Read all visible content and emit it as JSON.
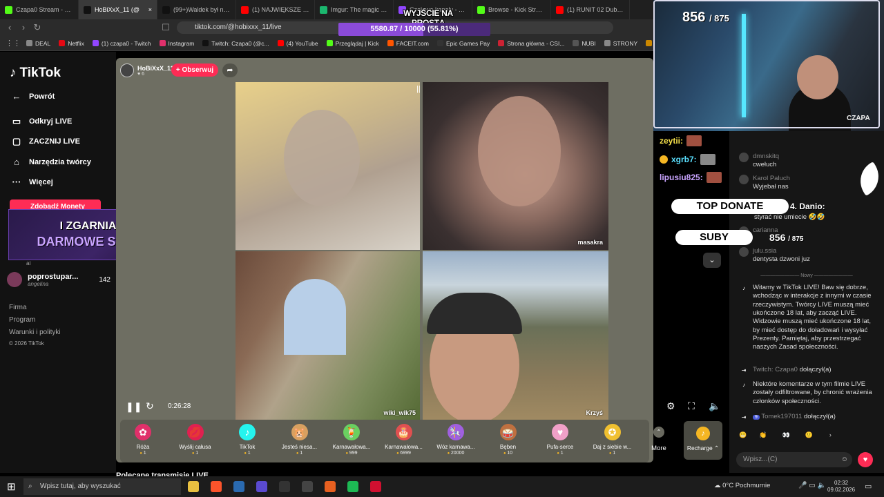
{
  "browser": {
    "tabs": [
      {
        "label": "Czapa0 Stream - Watc",
        "color": "#53fc18",
        "active": false
      },
      {
        "label": "HoBiXxX_11 (@",
        "color": "#111111",
        "active": true
      },
      {
        "label": "(99+)Waldek był na wy",
        "color": "#111111",
        "active": false
      },
      {
        "label": "(1) NAJWIĘKSZE WYGR",
        "color": "#ff0000",
        "active": false
      },
      {
        "label": "Imgur: The magic of th",
        "color": "#1bb76e",
        "active": false
      },
      {
        "label": "Czołowe kanały - Twitc",
        "color": "#9146ff",
        "active": false
      },
      {
        "label": "Browse - Kick Streamin",
        "color": "#53fc18",
        "active": false
      },
      {
        "label": "(1) RUNIT 02 Dubai - E",
        "color": "#ff0000",
        "active": false
      }
    ],
    "url": "tiktok.com/@hobixxx_11/live",
    "bookmarks": [
      {
        "label": "DEAL",
        "color": "#888888"
      },
      {
        "label": "Netflix",
        "color": "#e50914"
      },
      {
        "label": "(1) czapa0 - Twitch",
        "color": "#9146ff"
      },
      {
        "label": "Instagram",
        "color": "#e1306c"
      },
      {
        "label": "Twitch: Czapa0 (@c...",
        "color": "#111111"
      },
      {
        "label": "(4) YouTube",
        "color": "#ff0000"
      },
      {
        "label": "Przeglądaj | Kick",
        "color": "#53fc18"
      },
      {
        "label": "FACEIT.com",
        "color": "#ff5500"
      },
      {
        "label": "Epic Games Pay",
        "color": "#333333"
      },
      {
        "label": "Strona główna - CSI...",
        "color": "#cc2233"
      },
      {
        "label": "NUBI",
        "color": "#555555"
      },
      {
        "label": "STRONY",
        "color": "#888888"
      },
      {
        "label": "Skrzynki CS",
        "color": "#cc8800"
      }
    ]
  },
  "overlay": {
    "sub_goal_title": "WYJŚCIE NA PROSTĄ",
    "sub_goal_text": "5580.87 / 10000 (55.81%)",
    "sub_goal_progress": 0.5581,
    "viewers": "856",
    "viewers_goal": "/ 875",
    "cam_name": "CZAPA",
    "twitch_chat": [
      {
        "user": "zeytii:",
        "color": "#f5e04a"
      },
      {
        "user": "xgrb7:",
        "color": "#5ae0ff"
      },
      {
        "user": "lipusiu825:",
        "color": "#c9a4ff"
      }
    ],
    "top_donate_label": "TOP DONATE",
    "top_donate_amount": "",
    "top_donate_rank": "4. Danio:",
    "subs_label": "SUBY",
    "subs_count": "856",
    "subs_goal": "/ 875"
  },
  "sidebar": {
    "logo": "TikTok",
    "back": "Powrót",
    "items": [
      {
        "label": "Odkryj LIVE",
        "icon": "tv-icon"
      },
      {
        "label": "ZACZNIJ LIVE",
        "icon": "camera-icon"
      },
      {
        "label": "Narzędzia twórcy",
        "icon": "lightbulb-icon"
      },
      {
        "label": "Więcej",
        "icon": "ellipsis-icon"
      }
    ],
    "coins_button": "Zdobądź Monety",
    "promo_line1": "I ZGARNIAJ",
    "promo_line2": "DARMOWE SKINY",
    "following": [
      {
        "name": "poprostupar...",
        "sub": "angelina",
        "count": "142"
      }
    ],
    "partial_sub": "ai",
    "footer": [
      "Firma",
      "Program",
      "Warunki i polityki",
      "© 2026 TikTok"
    ]
  },
  "stream": {
    "host_name": "HoBiXxX_11",
    "host_likes": "6",
    "follow_label": "+ Obserwuj",
    "tiles": [
      {
        "label": ""
      },
      {
        "label": "masakra"
      },
      {
        "label": "wiki_wik75"
      },
      {
        "label": "Krzyś"
      }
    ],
    "time": "0:26:28"
  },
  "gifts": [
    {
      "name": "Róża",
      "price": "1",
      "icon": "rose-icon",
      "color": "#e0306a"
    },
    {
      "name": "Wyślij całusa",
      "price": "1",
      "icon": "lips-icon",
      "color": "#e02050"
    },
    {
      "name": "TikTok",
      "price": "1",
      "icon": "tiktok-icon",
      "color": "#25f4ee"
    },
    {
      "name": "Jesteś niesa...",
      "price": "1",
      "icon": "hamster-icon",
      "color": "#d8a060"
    },
    {
      "name": "Karnawałowa...",
      "price": "999",
      "icon": "cocktail-icon",
      "color": "#6ad060"
    },
    {
      "name": "Karnawałowa...",
      "price": "6999",
      "icon": "cake-icon",
      "color": "#e05050"
    },
    {
      "name": "Wóz karnawa...",
      "price": "20000",
      "icon": "float-icon",
      "color": "#a060e0"
    },
    {
      "name": "Bęben",
      "price": "10",
      "icon": "drum-icon",
      "color": "#c07040"
    },
    {
      "name": "Pufa-serce",
      "price": "1",
      "icon": "heart-pouf-icon",
      "color": "#f0a0c8"
    },
    {
      "name": "Daj z siebie w...",
      "price": "1",
      "icon": "medal-icon",
      "color": "#f0c030"
    }
  ],
  "gift_more": "More",
  "recharge": "Recharge",
  "recommended": "Polecane transmisje LIVE",
  "chat": {
    "messages_old": [
      {
        "user": "dmnskitq",
        "text": "cwełuch"
      },
      {
        "user": "Karol Paluch",
        "text": "Wyjebał nas"
      },
      {
        "user": "",
        "text": "styrać nie umiecie 🤣🤣"
      },
      {
        "user": "carianna",
        "text": ""
      },
      {
        "user": "julu.ssia",
        "text": "dentysta dzwoni juz"
      }
    ],
    "divider": "Nowy",
    "system_welcome": "Witamy w TikTok LIVE! Baw się dobrze, wchodząc w interakcje z innymi w czasie rzeczywistym. Twórcy LIVE muszą mieć ukończone 18 lat, aby zacząć LIVE. Widzowie muszą mieć ukończone 18 lat, by mieć dostęp do doładowań i wysyłać Prezenty. Pamiętaj, aby przestrzegać naszych Zasad społeczności.",
    "join1_user": "Twitch: Czapa0",
    "join1_text": "dołączył(a)",
    "system_filter": "Niektóre komentarze w tym filmie LIVE zostały odfiltrowane, by chronić wrażenia członków społeczności.",
    "join2_level": "9",
    "join2_user": "Tomek197011",
    "join2_text": "dołączył(a)",
    "input_placeholder": "Wpisz...(C)"
  },
  "taskbar": {
    "search": "Wpisz tutaj, aby wyszukać",
    "weather": "0°C  Pochmurnie",
    "time": "02:32",
    "date": "09.02.2026",
    "apps": [
      "#e8c040",
      "#fb542b",
      "#2a6ab0",
      "#5a4ad0",
      "#333333",
      "#444444",
      "#e86020",
      "#1db954",
      "#d01030"
    ]
  }
}
